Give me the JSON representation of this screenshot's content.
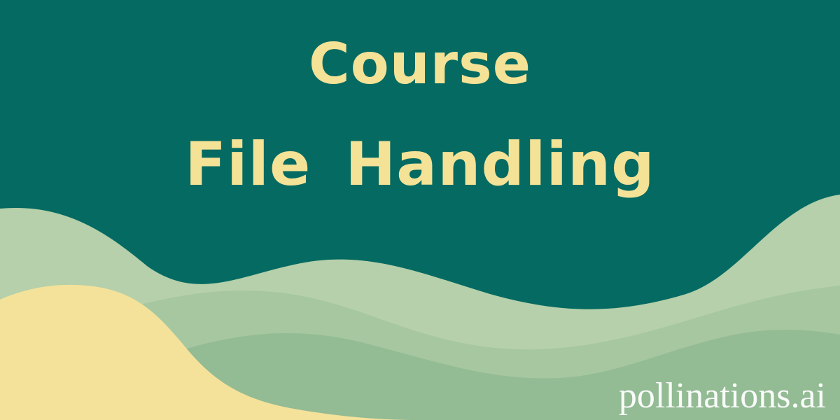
{
  "banner": {
    "title_line_1": "Course",
    "title_line_2": "File Handling",
    "watermark": "pollinations.ai"
  },
  "colors": {
    "background": "#046a62",
    "title_text": "#f4e296",
    "wave_light_green": "#b3cfa8",
    "wave_mid_green": "#9fc19a",
    "wave_deep_green": "#8eb592",
    "wave_sand": "#f4e29a",
    "watermark_text": "#ffffff"
  }
}
